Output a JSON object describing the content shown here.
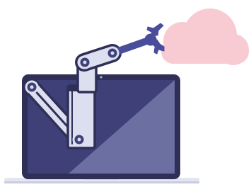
{
  "illustration": {
    "subject": "robot-arm-from-laptop-to-cloud",
    "icons": [
      "laptop-icon",
      "robot-arm-icon",
      "gripper-claw-icon",
      "cloud-icon"
    ],
    "colors": {
      "background": "#ffffff",
      "cloud": "#f8cbd2",
      "laptop_frame": "#2f2f57",
      "laptop_screen_dark": "#3e4077",
      "laptop_screen_light": "#6c6fa1",
      "laptop_base": "#e3e5f1",
      "laptop_base_edge": "#c9cce0",
      "arm_light": "#dcdff0",
      "arm_outline": "#2f2f57",
      "arm_joint": "#3e4078",
      "claw": "#4a4e9a"
    }
  }
}
